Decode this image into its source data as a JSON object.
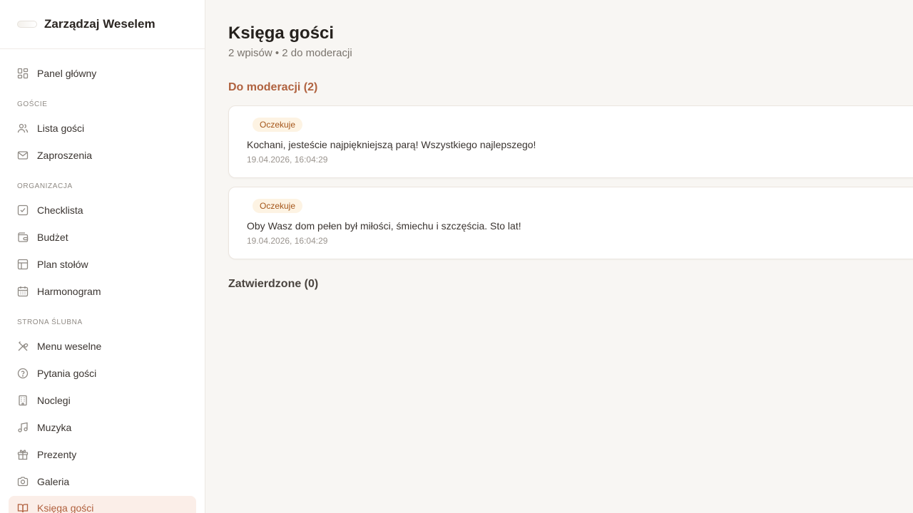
{
  "brand": {
    "title": "Zarządzaj Weselem"
  },
  "nav": {
    "dashboard": "Panel główny",
    "sections": {
      "guests": "GOŚCIE",
      "organization": "ORGANIZACJA",
      "website": "STRONA ŚLUBNA"
    },
    "items": {
      "guest_list": "Lista gości",
      "invitations": "Zaproszenia",
      "checklist": "Checklista",
      "budget": "Budżet",
      "seating": "Plan stołów",
      "schedule": "Harmonogram",
      "menu": "Menu weselne",
      "questions": "Pytania gości",
      "lodging": "Noclegi",
      "music": "Muzyka",
      "gifts": "Prezenty",
      "gallery": "Galeria",
      "guestbook": "Księga gości"
    }
  },
  "page": {
    "title": "Księga gości",
    "subtitle": "2 wpisów • 2 do moderacji"
  },
  "pending": {
    "heading": "Do moderacji (2)",
    "entries": [
      {
        "badge": "Oczekuje",
        "text": "Kochani, jesteście najpiękniejszą parą! Wszystkiego najlepszego!",
        "time": "19.04.2026, 16:04:29"
      },
      {
        "badge": "Oczekuje",
        "text": "Oby Wasz dom pełen był miłości, śmiechu i szczęścia. Sto lat!",
        "time": "19.04.2026, 16:04:29"
      }
    ]
  },
  "approved": {
    "heading": "Zatwierdzone (0)"
  },
  "colors": {
    "accent": "#b0623f",
    "badge_bg": "#fdf3e3",
    "badge_text": "#a4561a",
    "active_bg": "#fbeee8"
  }
}
